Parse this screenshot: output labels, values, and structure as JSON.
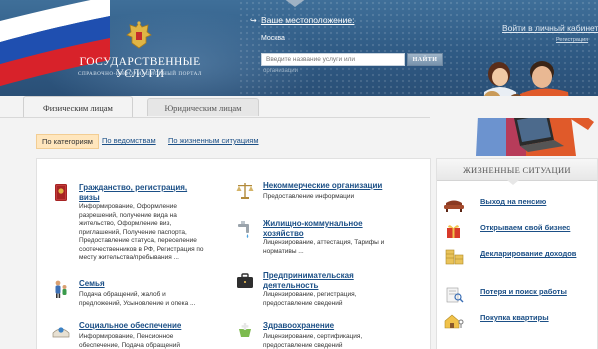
{
  "header": {
    "title": "ГОСУДАРСТВЕННЫЕ УСЛУГИ",
    "subtitle": "СПРАВОЧНО-ИНФОРМАЦИОННЫЙ ПОРТАЛ",
    "location_label": "Ваше местоположение:",
    "location_value": "Москва",
    "search_placeholder": "Введите название услуги или",
    "search_button": "НАЙТИ",
    "search_hint": "организации",
    "cabinet_link": "Войти в личный кабинет",
    "register_link": "Регистрация"
  },
  "tabs": [
    {
      "label": "Физическим лицам",
      "active": true
    },
    {
      "label": "Юридическим лицам",
      "active": false
    }
  ],
  "filters": [
    {
      "label": "По категориям",
      "active": true
    },
    {
      "label": "По ведомствам",
      "active": false
    },
    {
      "label": "По жизненным ситуациям",
      "active": false
    }
  ],
  "categories": [
    {
      "icon": "passport-icon",
      "title": "Гражданство, регистрация, визы",
      "desc": "Информирование, Оформление разрешений, получение вида на жительство, Оформление виз, приглашений, Получение паспорта, Предоставление статуса, переселение соотечественников в РФ, Регистрация по месту жительства/пребывания ..."
    },
    {
      "icon": "family-icon",
      "title": "Семья",
      "desc": "Подача обращений, жалоб и предложений, Усыновление и опека ..."
    },
    {
      "icon": "social-care-icon",
      "title": "Социальное обеспечение",
      "desc": "Информирование, Пенсионное обеспечение, Подача обращений"
    },
    {
      "icon": "scales-icon",
      "title": "Некоммерческие организации",
      "desc": "Предоставление информации"
    },
    {
      "icon": "faucet-icon",
      "title": "Жилищно-коммунальное хозяйство",
      "desc": "Лицензирование, аттестация, Тарифы и нормативы ..."
    },
    {
      "icon": "briefcase-icon",
      "title": "Предпринимательская деятельность",
      "desc": "Лицензирование, регистрация, предоставление сведений"
    },
    {
      "icon": "medicine-icon",
      "title": "Здравоохранение",
      "desc": "Лицензирование, сертификация, предоставление сведений"
    }
  ],
  "life_situations": {
    "title": "ЖИЗНЕННЫЕ СИТУАЦИИ",
    "items": [
      {
        "icon": "armchair-icon",
        "label": "Выход на пенсию"
      },
      {
        "icon": "gift-box-icon",
        "label": "Открываем свой бизнес"
      },
      {
        "icon": "coins-stack-icon",
        "label": "Декларирование доходов"
      },
      {
        "icon": "document-search-icon",
        "label": "Потеря и поиск работы"
      },
      {
        "icon": "house-keys-icon",
        "label": "Покупка квартиры"
      }
    ]
  },
  "colors": {
    "header_blue": "#2f5a84",
    "link_blue": "#1b4f86",
    "active_filter_bg": "#ffe6bd"
  }
}
